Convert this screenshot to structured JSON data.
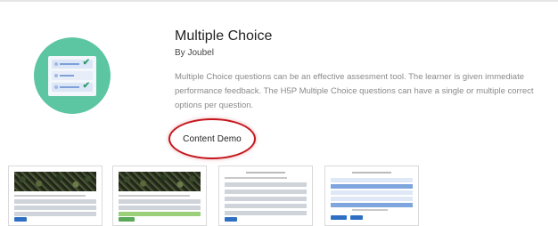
{
  "content": {
    "title": "Multiple Choice",
    "author": "By Joubel",
    "description": "Multiple Choice questions can be an effective assesment tool. The learner is given immediate performance feedback. The H5P Multiple Choice questions can have a single or multiple correct options per question.",
    "demo_button": "Content Demo"
  },
  "icon": {
    "name": "multiple-choice-icon",
    "background_color": "#5cc5a2",
    "check_color": "#2d9b6b",
    "check_glyph": "✔"
  },
  "highlight": {
    "ring_color": "#c4161c"
  },
  "screenshots": {
    "count": 4
  }
}
